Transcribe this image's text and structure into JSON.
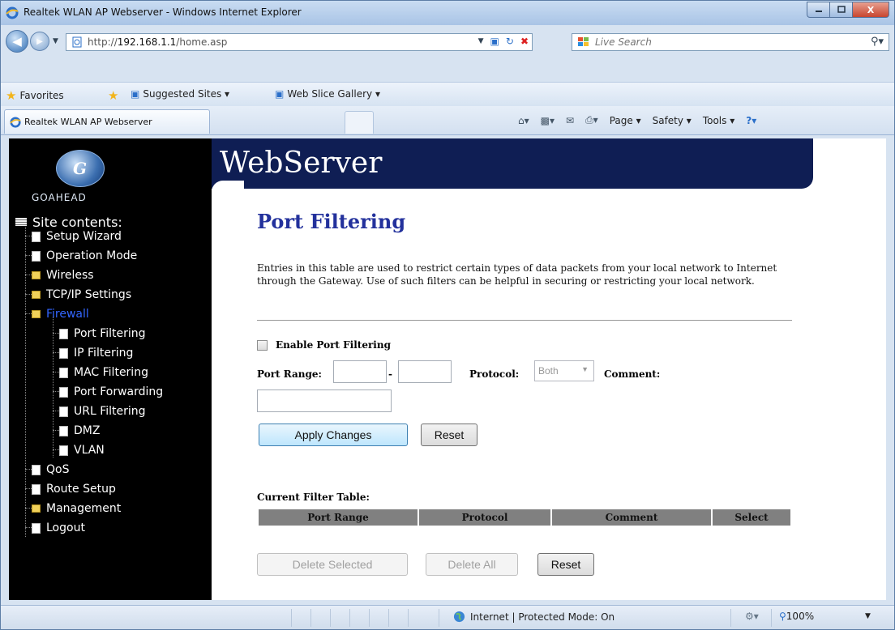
{
  "window": {
    "title": "Realtek WLAN AP Webserver - Windows Internet Explorer",
    "minimize_icon": "minimize-icon",
    "maximize_icon": "maximize-icon",
    "close_label": "X"
  },
  "address_bar": {
    "url_prefix": "http://",
    "url_host": "192.168.1.1",
    "url_path": "/home.asp",
    "search_placeholder": "Live Search"
  },
  "favorites_bar": {
    "favorites_label": "Favorites",
    "suggested_sites": "Suggested Sites ▾",
    "web_slice_gallery": "Web Slice Gallery ▾"
  },
  "tabs": {
    "active_tab": "Realtek WLAN AP Webserver"
  },
  "command_bar": {
    "page": "Page ▾",
    "safety": "Safety ▾",
    "tools": "Tools ▾",
    "help": "?▾"
  },
  "sidebar": {
    "logo_text": "GOAHEAD",
    "root_label": "Site contents:",
    "items": [
      {
        "label": "Setup Wizard"
      },
      {
        "label": "Operation Mode"
      },
      {
        "label": "Wireless"
      },
      {
        "label": "TCP/IP Settings"
      },
      {
        "label": "Firewall"
      },
      {
        "label": "Port Filtering"
      },
      {
        "label": "IP Filtering"
      },
      {
        "label": "MAC Filtering"
      },
      {
        "label": "Port Forwarding"
      },
      {
        "label": "URL Filtering"
      },
      {
        "label": "DMZ"
      },
      {
        "label": "VLAN"
      },
      {
        "label": "QoS"
      },
      {
        "label": "Route Setup"
      },
      {
        "label": "Management"
      },
      {
        "label": "Logout"
      }
    ]
  },
  "banner": {
    "title": "WebServer"
  },
  "main": {
    "page_title": "Port Filtering",
    "description": "Entries in this table are used to restrict certain types of data packets from your local network to Internet through the Gateway. Use of such filters can be helpful in securing or restricting your local network.",
    "enable_label": "Enable Port Filtering",
    "port_range_label": "Port Range:",
    "port_range_separator": "-",
    "protocol_label": "Protocol:",
    "protocol_value": "Both",
    "comment_label": "Comment:",
    "apply_button": "Apply Changes",
    "reset_button": "Reset",
    "table_label": "Current Filter Table:",
    "table_headers": [
      "Port Range",
      "Protocol",
      "Comment",
      "Select"
    ],
    "delete_selected_button": "Delete Selected",
    "delete_all_button": "Delete All",
    "reset_button_2": "Reset"
  },
  "status_bar": {
    "zone": "Internet | Protected Mode: On",
    "zoom": "100%"
  }
}
